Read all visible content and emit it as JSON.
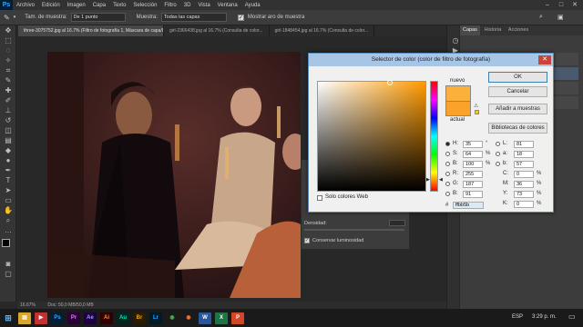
{
  "menu": {
    "logo": "Ps",
    "items": [
      "Archivo",
      "Edición",
      "Imagen",
      "Capa",
      "Texto",
      "Selección",
      "Filtro",
      "3D",
      "Vista",
      "Ventana",
      "Ayuda"
    ]
  },
  "options": {
    "sample_size_label": "Tam. de muestra:",
    "sample_size_value": "De 1 punto",
    "sample_label": "Muestra:",
    "sample_value": "Todas las capas",
    "show_ring_label": "Mostrar aro de muestra"
  },
  "doc_tabs": [
    "three-3075752.jpg al 16.7% (Filtro de fotografía 1, Máscara de capa/8) *",
    "girl-2366438.jpg al 16.7% (Consulta de color...",
    "girl-1848454.jpg al 16.7% (Consulta de color..."
  ],
  "status": {
    "zoom": "16.67%",
    "doc": "Doc: 50,0 MB/50,0 MB"
  },
  "panels": {
    "tabs": [
      "Capas",
      "Historia",
      "Acciones"
    ],
    "density_label": "Densidad:",
    "preserve_label": "Conservar luminosidad"
  },
  "dialog": {
    "title": "Selector de color (color de filtro de fotografía)",
    "ok": "OK",
    "cancel": "Cancelar",
    "add_swatches": "Añadir a muestras",
    "libraries": "Bibliotecas de colores",
    "new_label": "nuevo",
    "current_label": "actual",
    "web_only": "Solo colores Web",
    "new_color": "#fbb03b",
    "current_color": "#fba22b",
    "fields": {
      "H": "35",
      "S": "64",
      "B": "100",
      "R": "255",
      "G": "187",
      "B2": "91",
      "L": "81",
      "a": "18",
      "b": "57",
      "C": "0",
      "M": "36",
      "Y": "73",
      "K": "0",
      "hex": "ffbb5b"
    },
    "units": {
      "deg": "°",
      "pct": "%"
    }
  },
  "taskbar": {
    "lang": "ESP",
    "time": "3:29 p. m.",
    "apps": [
      "Ps",
      "Pr",
      "Ae",
      "Ai",
      "Au",
      "Br",
      "Lr"
    ]
  }
}
